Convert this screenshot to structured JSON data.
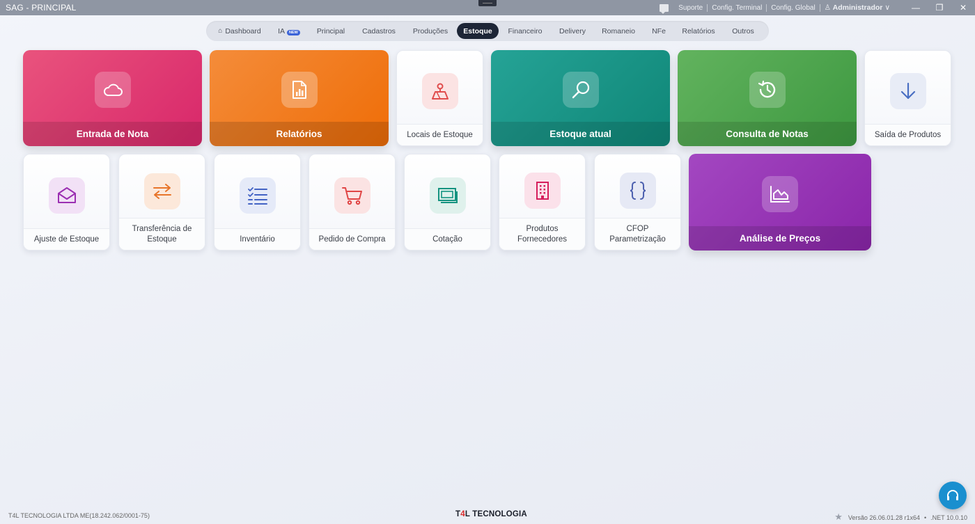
{
  "window": {
    "title": "SAG - PRINCIPAL",
    "links": [
      "Suporte",
      "Config. Terminal",
      "Config. Global"
    ],
    "user": "Administrador",
    "controls": {
      "minimize": "—",
      "restore": "❐",
      "close": "✕"
    }
  },
  "nav": {
    "tabs": [
      {
        "label": "Dashboard",
        "icon": "home-icon"
      },
      {
        "label": "IA",
        "badge": "NEW"
      },
      {
        "label": "Principal"
      },
      {
        "label": "Cadastros"
      },
      {
        "label": "Produções"
      },
      {
        "label": "Estoque",
        "active": true
      },
      {
        "label": "Financeiro"
      },
      {
        "label": "Delivery"
      },
      {
        "label": "Romaneio"
      },
      {
        "label": "NFe"
      },
      {
        "label": "Relatórios"
      },
      {
        "label": "Outros"
      }
    ]
  },
  "tiles": {
    "entrada_nota": {
      "label": "Entrada de Nota",
      "icon": "cloud-icon",
      "color": "#dd3470"
    },
    "relatorios": {
      "label": "Relatórios",
      "icon": "report-icon",
      "color": "#f07a1a"
    },
    "locais_estoque": {
      "label": "Locais de Estoque",
      "icon": "location-icon",
      "color": "#e04c4c"
    },
    "estoque_atual": {
      "label": "Estoque atual",
      "icon": "search-icon",
      "color": "#1a9586"
    },
    "consulta_notas": {
      "label": "Consulta de Notas",
      "icon": "history-icon",
      "color": "#4ea54e"
    },
    "saida_produtos": {
      "label": "Saída de Produtos",
      "icon": "arrow-down-icon",
      "color": "#4a6fc2"
    },
    "ajuste_estoque": {
      "label": "Ajuste de Estoque",
      "icon": "envelope-icon",
      "color": "#9b2fb2"
    },
    "transferencia_estoque": {
      "label_line1": "Transferência de",
      "label_line2": "Estoque",
      "icon": "swap-icon",
      "color": "#e8752a"
    },
    "inventario": {
      "label": "Inventário",
      "icon": "checklist-icon",
      "color": "#4363c4"
    },
    "pedido_compra": {
      "label": "Pedido de Compra",
      "icon": "cart-icon",
      "color": "#e04545"
    },
    "cotacao": {
      "label": "Cotação",
      "icon": "copy-icon",
      "color": "#159380"
    },
    "produtos_fornecedores": {
      "label_line1": "Produtos",
      "label_line2": "Fornecedores",
      "icon": "building-icon",
      "color": "#d61f5d"
    },
    "cfop": {
      "label_line1": "CFOP",
      "label_line2": "Parametrização",
      "icon": "braces-icon",
      "color": "#4b5fae"
    },
    "analise_precos": {
      "label": "Análise de Preços",
      "icon": "area-chart-icon",
      "color": "#9534b5"
    }
  },
  "footer": {
    "company": "T4L TECNOLOGIA LTDA ME(18.242.062/0001-75)",
    "brand_prefix": "T",
    "brand_mark": "4",
    "brand_suffix": "L TECNOLOGIA",
    "version": "Versão 26.06.01.28 r1x64",
    "dot": "•",
    "runtime": ".NET 10.0.10"
  }
}
